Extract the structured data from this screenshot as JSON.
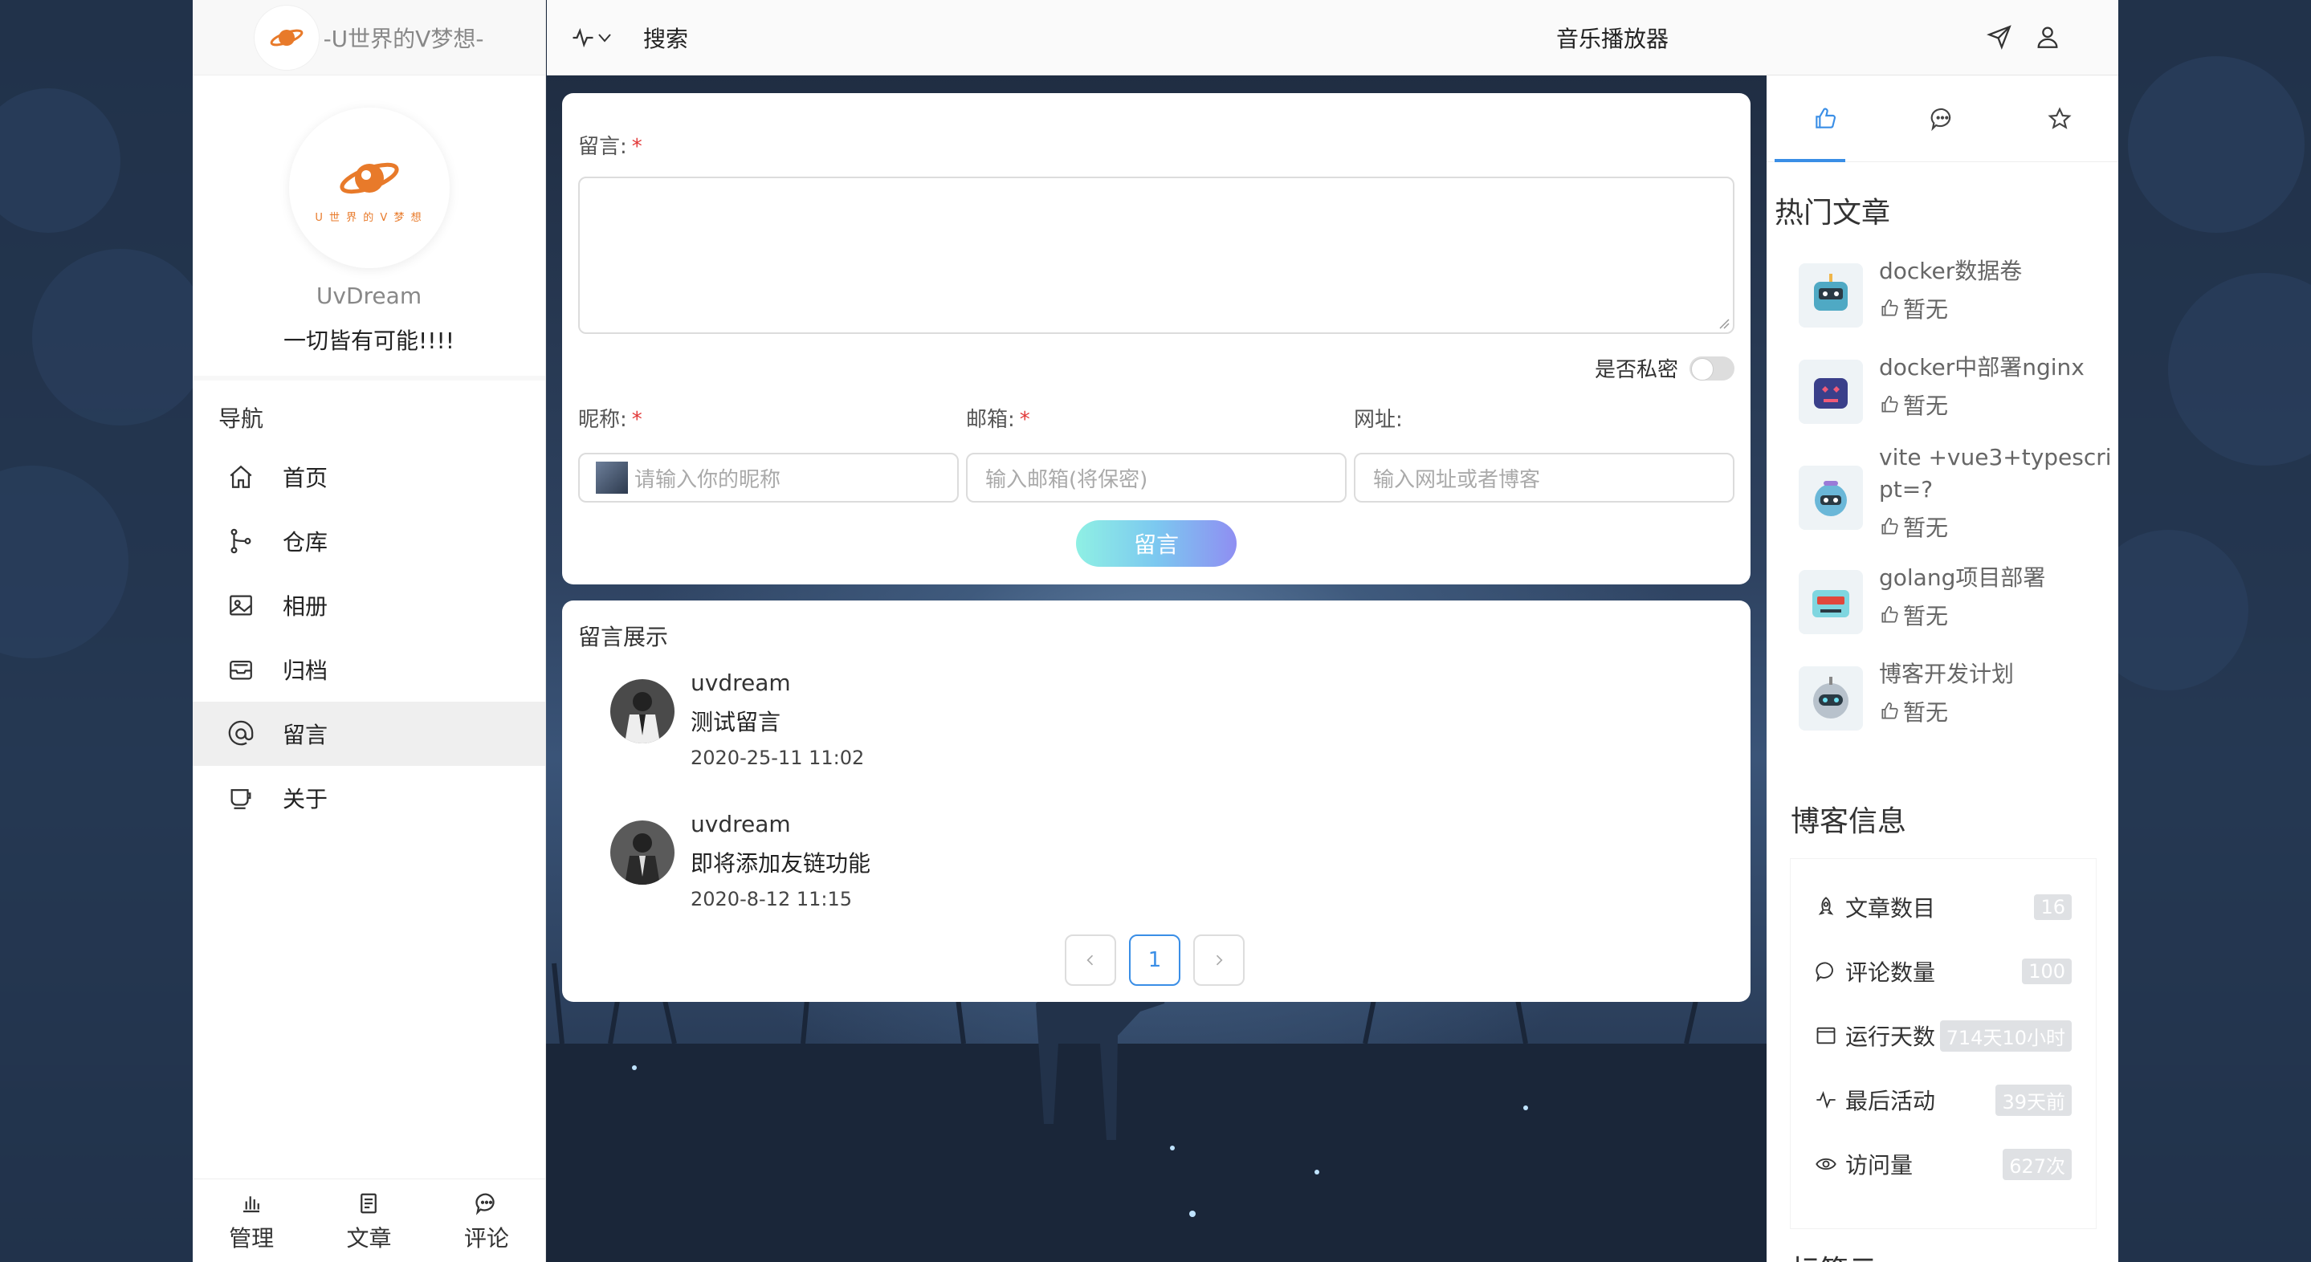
{
  "brand": {
    "site_name": "-U世界的V梦想-",
    "logo_caption": "U 世 界 的 V 梦 想",
    "accent_color": "#e87a2a"
  },
  "profile": {
    "username": "UvDream",
    "motto": "一切皆有可能!!!!"
  },
  "nav": {
    "title": "导航",
    "items": [
      {
        "label": "首页",
        "icon": "home-icon"
      },
      {
        "label": "仓库",
        "icon": "branch-icon"
      },
      {
        "label": "相册",
        "icon": "image-icon"
      },
      {
        "label": "归档",
        "icon": "archive-icon"
      },
      {
        "label": "留言",
        "icon": "at-icon"
      },
      {
        "label": "关于",
        "icon": "cup-icon"
      }
    ],
    "active_index": 4
  },
  "bottom_bar": {
    "items": [
      {
        "label": "管理",
        "icon": "bar-chart-icon"
      },
      {
        "label": "文章",
        "icon": "document-icon"
      },
      {
        "label": "评论",
        "icon": "comment-icon"
      }
    ]
  },
  "topbar": {
    "search_label": "搜索",
    "music_label": "音乐播放器"
  },
  "form": {
    "message_label": "留言:",
    "required_mark": "*",
    "private_label": "是否私密",
    "nickname_label": "昵称:",
    "email_label": "邮箱:",
    "website_label": "网址:",
    "nickname_placeholder": "请输入你的昵称",
    "email_placeholder": "输入邮箱(将保密)",
    "website_placeholder": "输入网址或者博客",
    "submit_label": "留言"
  },
  "messages": {
    "title": "留言展示",
    "items": [
      {
        "name": "uvdream",
        "text": "测试留言",
        "time": "2020-25-11 11:02"
      },
      {
        "name": "uvdream",
        "text": "即将添加友链功能",
        "time": "2020-8-12 11:15"
      }
    ],
    "pagination": {
      "prev": "<",
      "current": "1",
      "next": ">"
    }
  },
  "right_sidebar": {
    "tabs": [
      "thumbs-up-icon",
      "comment-icon",
      "star-icon"
    ],
    "hot_title": "热门文章",
    "hot_articles": [
      {
        "title": "docker数据卷",
        "likes": "暂无"
      },
      {
        "title": "docker中部署nginx",
        "likes": "暂无"
      },
      {
        "title": "vite +vue3+typescript=?",
        "likes": "暂无"
      },
      {
        "title": "golang项目部署",
        "likes": "暂无"
      },
      {
        "title": "博客开发计划",
        "likes": "暂无"
      }
    ],
    "blog_info_title": "博客信息",
    "blog_info": [
      {
        "label": "文章数目",
        "value": "16",
        "icon": "rocket-icon"
      },
      {
        "label": "评论数量",
        "value": "100",
        "icon": "comment-icon"
      },
      {
        "label": "运行天数",
        "value": "714天10小时",
        "icon": "calendar-icon"
      },
      {
        "label": "最后活动",
        "value": "39天前",
        "icon": "pulse-icon"
      },
      {
        "label": "访问量",
        "value": "627次",
        "icon": "eye-icon"
      }
    ],
    "tags_title": "标签云"
  }
}
